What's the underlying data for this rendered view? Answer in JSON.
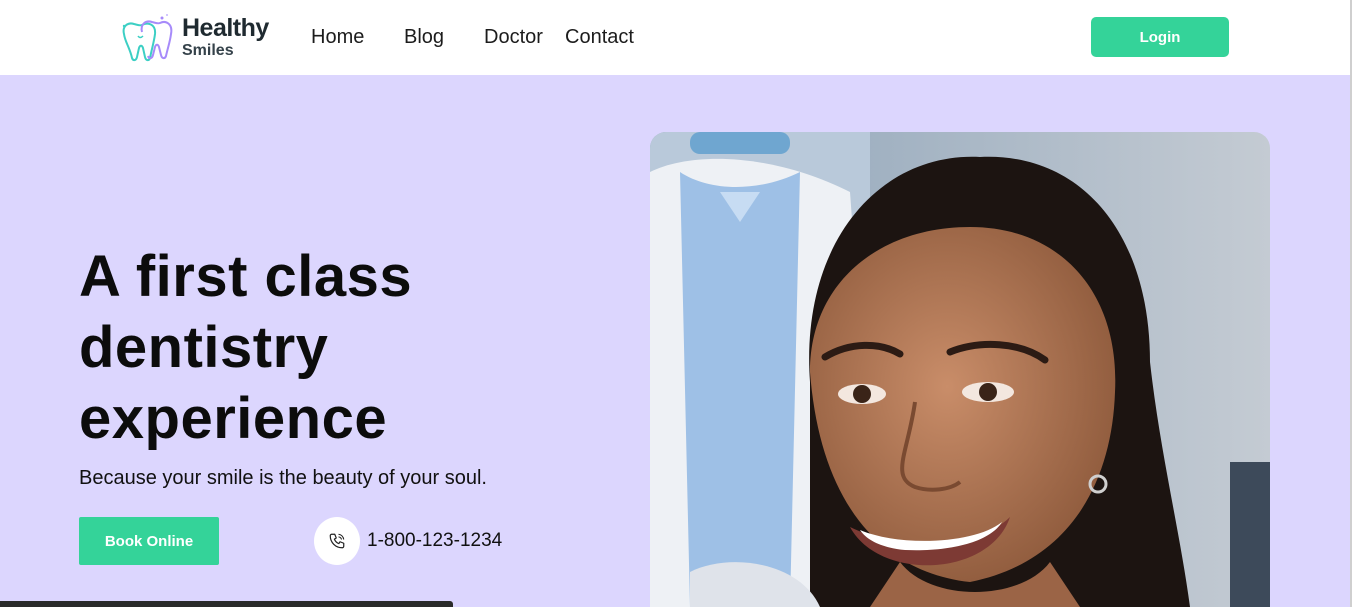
{
  "brand": {
    "name_line1": "Healthy",
    "name_line2": "Smiles"
  },
  "nav": {
    "home": "Home",
    "blog": "Blog",
    "doctor": "Doctor",
    "contact": "Contact"
  },
  "header": {
    "login_label": "Login"
  },
  "hero": {
    "headline_line1": "A first class",
    "headline_line2": "dentistry",
    "headline_line3": "experience",
    "tagline": "Because your smile is the beauty of your soul.",
    "book_label": "Book Online",
    "phone": "1-800-123-1234",
    "phone_icon": "phone-icon"
  },
  "colors": {
    "accent": "#34d399",
    "hero_bg": "#dcd6fe",
    "text": "#0c0c0c"
  }
}
